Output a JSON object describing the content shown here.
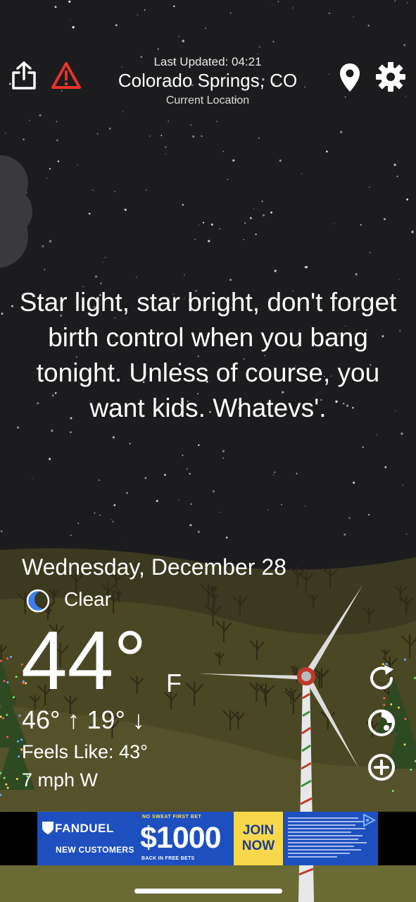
{
  "header": {
    "last_updated": "Last Updated: 04:21",
    "location": "Colorado Springs, CO",
    "location_sub": "Current Location"
  },
  "icons": {
    "share": "share-icon",
    "alert": "warning-triangle-icon",
    "location": "location-pin-icon",
    "settings": "gear-icon",
    "moon": "crescent-moon-icon",
    "refresh": "refresh-icon",
    "radar": "radar-icon",
    "add": "plus-circle-icon"
  },
  "quote": "Star light, star bright, don't forget birth control when you bang tonight. Unless of course, you want kids. Whatevs'.",
  "weather": {
    "date": "Wednesday, December 28",
    "condition": "Clear",
    "temperature": "44°",
    "unit": "F",
    "hilo": "46° ↑ 19° ↓",
    "feels_like": "Feels Like: 43°",
    "wind": "7 mph W"
  },
  "ad": {
    "brand": "FANDUEL",
    "customers": "NEW CUSTOMERS",
    "tagline": "NO SWEAT FIRST BET",
    "amount": "$1000",
    "back": "BACK IN FREE BETS",
    "cta_line1": "JOIN",
    "cta_line2": "NOW"
  },
  "colors": {
    "sky": "#1c1c1e",
    "hills": "#4c4a27",
    "alert_red": "#e5332a",
    "moon_blue": "#3d7ff0",
    "ad_blue": "#1d4fbf",
    "ad_yellow": "#f6d84a"
  }
}
